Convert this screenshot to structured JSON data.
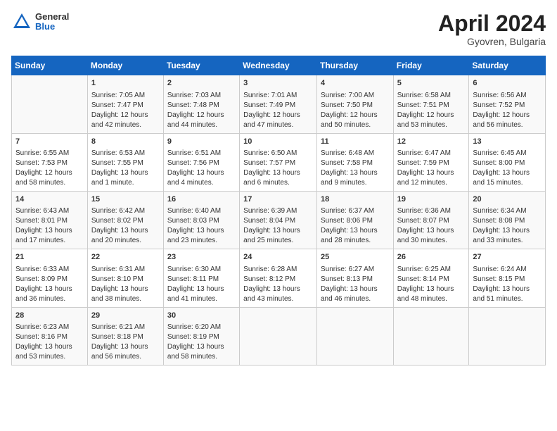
{
  "header": {
    "logo_general": "General",
    "logo_blue": "Blue",
    "month_title": "April 2024",
    "location": "Gyovren, Bulgaria"
  },
  "weekdays": [
    "Sunday",
    "Monday",
    "Tuesday",
    "Wednesday",
    "Thursday",
    "Friday",
    "Saturday"
  ],
  "weeks": [
    [
      {
        "day": "",
        "info": ""
      },
      {
        "day": "1",
        "info": "Sunrise: 7:05 AM\nSunset: 7:47 PM\nDaylight: 12 hours\nand 42 minutes."
      },
      {
        "day": "2",
        "info": "Sunrise: 7:03 AM\nSunset: 7:48 PM\nDaylight: 12 hours\nand 44 minutes."
      },
      {
        "day": "3",
        "info": "Sunrise: 7:01 AM\nSunset: 7:49 PM\nDaylight: 12 hours\nand 47 minutes."
      },
      {
        "day": "4",
        "info": "Sunrise: 7:00 AM\nSunset: 7:50 PM\nDaylight: 12 hours\nand 50 minutes."
      },
      {
        "day": "5",
        "info": "Sunrise: 6:58 AM\nSunset: 7:51 PM\nDaylight: 12 hours\nand 53 minutes."
      },
      {
        "day": "6",
        "info": "Sunrise: 6:56 AM\nSunset: 7:52 PM\nDaylight: 12 hours\nand 56 minutes."
      }
    ],
    [
      {
        "day": "7",
        "info": "Sunrise: 6:55 AM\nSunset: 7:53 PM\nDaylight: 12 hours\nand 58 minutes."
      },
      {
        "day": "8",
        "info": "Sunrise: 6:53 AM\nSunset: 7:55 PM\nDaylight: 13 hours\nand 1 minute."
      },
      {
        "day": "9",
        "info": "Sunrise: 6:51 AM\nSunset: 7:56 PM\nDaylight: 13 hours\nand 4 minutes."
      },
      {
        "day": "10",
        "info": "Sunrise: 6:50 AM\nSunset: 7:57 PM\nDaylight: 13 hours\nand 6 minutes."
      },
      {
        "day": "11",
        "info": "Sunrise: 6:48 AM\nSunset: 7:58 PM\nDaylight: 13 hours\nand 9 minutes."
      },
      {
        "day": "12",
        "info": "Sunrise: 6:47 AM\nSunset: 7:59 PM\nDaylight: 13 hours\nand 12 minutes."
      },
      {
        "day": "13",
        "info": "Sunrise: 6:45 AM\nSunset: 8:00 PM\nDaylight: 13 hours\nand 15 minutes."
      }
    ],
    [
      {
        "day": "14",
        "info": "Sunrise: 6:43 AM\nSunset: 8:01 PM\nDaylight: 13 hours\nand 17 minutes."
      },
      {
        "day": "15",
        "info": "Sunrise: 6:42 AM\nSunset: 8:02 PM\nDaylight: 13 hours\nand 20 minutes."
      },
      {
        "day": "16",
        "info": "Sunrise: 6:40 AM\nSunset: 8:03 PM\nDaylight: 13 hours\nand 23 minutes."
      },
      {
        "day": "17",
        "info": "Sunrise: 6:39 AM\nSunset: 8:04 PM\nDaylight: 13 hours\nand 25 minutes."
      },
      {
        "day": "18",
        "info": "Sunrise: 6:37 AM\nSunset: 8:06 PM\nDaylight: 13 hours\nand 28 minutes."
      },
      {
        "day": "19",
        "info": "Sunrise: 6:36 AM\nSunset: 8:07 PM\nDaylight: 13 hours\nand 30 minutes."
      },
      {
        "day": "20",
        "info": "Sunrise: 6:34 AM\nSunset: 8:08 PM\nDaylight: 13 hours\nand 33 minutes."
      }
    ],
    [
      {
        "day": "21",
        "info": "Sunrise: 6:33 AM\nSunset: 8:09 PM\nDaylight: 13 hours\nand 36 minutes."
      },
      {
        "day": "22",
        "info": "Sunrise: 6:31 AM\nSunset: 8:10 PM\nDaylight: 13 hours\nand 38 minutes."
      },
      {
        "day": "23",
        "info": "Sunrise: 6:30 AM\nSunset: 8:11 PM\nDaylight: 13 hours\nand 41 minutes."
      },
      {
        "day": "24",
        "info": "Sunrise: 6:28 AM\nSunset: 8:12 PM\nDaylight: 13 hours\nand 43 minutes."
      },
      {
        "day": "25",
        "info": "Sunrise: 6:27 AM\nSunset: 8:13 PM\nDaylight: 13 hours\nand 46 minutes."
      },
      {
        "day": "26",
        "info": "Sunrise: 6:25 AM\nSunset: 8:14 PM\nDaylight: 13 hours\nand 48 minutes."
      },
      {
        "day": "27",
        "info": "Sunrise: 6:24 AM\nSunset: 8:15 PM\nDaylight: 13 hours\nand 51 minutes."
      }
    ],
    [
      {
        "day": "28",
        "info": "Sunrise: 6:23 AM\nSunset: 8:16 PM\nDaylight: 13 hours\nand 53 minutes."
      },
      {
        "day": "29",
        "info": "Sunrise: 6:21 AM\nSunset: 8:18 PM\nDaylight: 13 hours\nand 56 minutes."
      },
      {
        "day": "30",
        "info": "Sunrise: 6:20 AM\nSunset: 8:19 PM\nDaylight: 13 hours\nand 58 minutes."
      },
      {
        "day": "",
        "info": ""
      },
      {
        "day": "",
        "info": ""
      },
      {
        "day": "",
        "info": ""
      },
      {
        "day": "",
        "info": ""
      }
    ]
  ]
}
